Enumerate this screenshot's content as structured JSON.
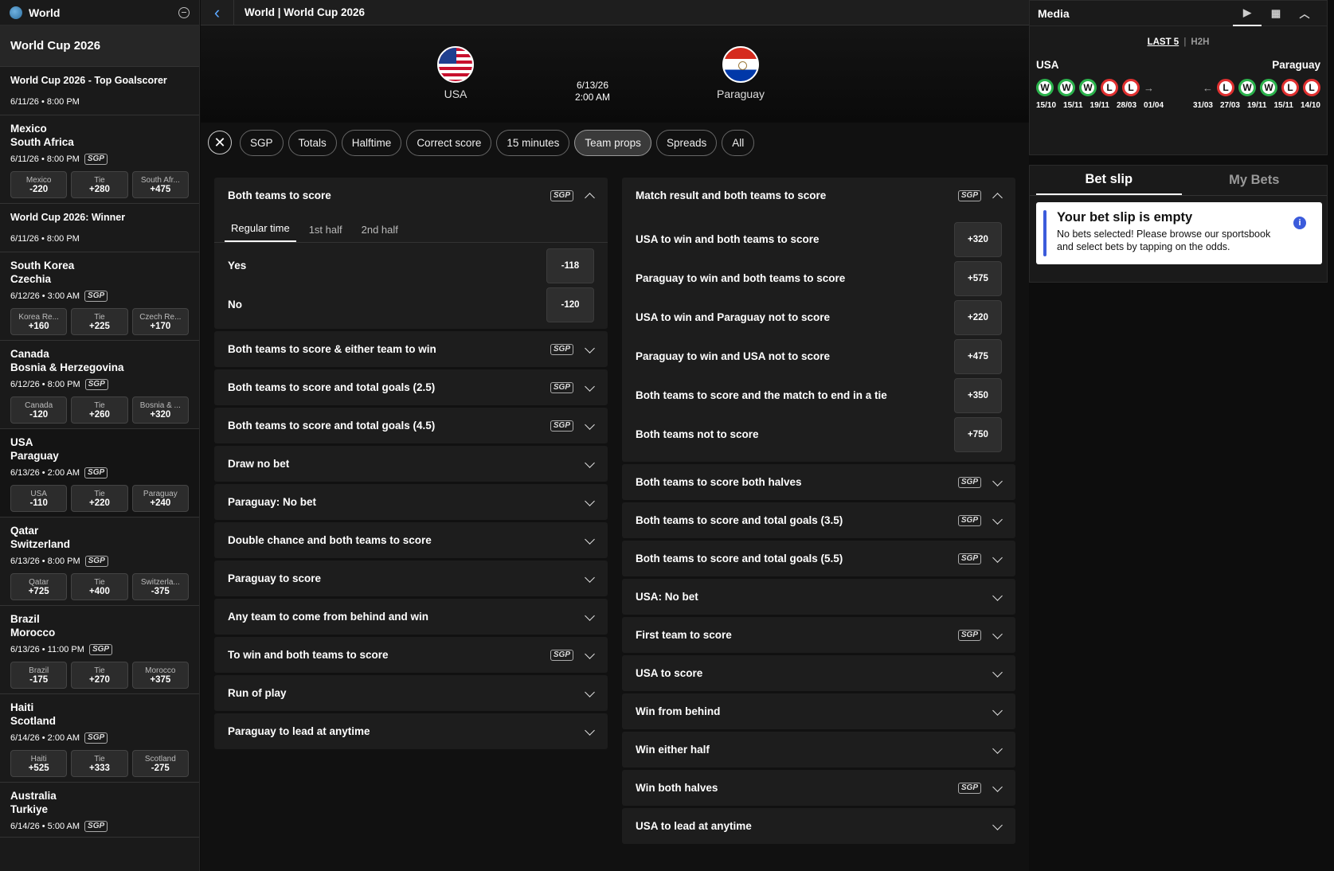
{
  "sidebar": {
    "title": "World",
    "section": "World Cup 2026",
    "outrights": [
      {
        "title": "World Cup 2026 - Top Goalscorer",
        "date": "6/11/26 • 8:00 PM"
      },
      {
        "title": "World Cup 2026: Winner",
        "date": "6/11/26 • 8:00 PM"
      }
    ],
    "matches": [
      {
        "home": "Mexico",
        "away": "South Africa",
        "date": "6/11/26 • 8:00 PM",
        "sgp": "SGP",
        "odds": [
          {
            "l": "Mexico",
            "v": "-220"
          },
          {
            "l": "Tie",
            "v": "+280"
          },
          {
            "l": "South Afr...",
            "v": "+475"
          }
        ]
      },
      {
        "home": "South Korea",
        "away": "Czechia",
        "date": "6/12/26 • 3:00 AM",
        "sgp": "SGP",
        "odds": [
          {
            "l": "Korea Re...",
            "v": "+160"
          },
          {
            "l": "Tie",
            "v": "+225"
          },
          {
            "l": "Czech Re...",
            "v": "+170"
          }
        ]
      },
      {
        "home": "Canada",
        "away": "Bosnia & Herzegovina",
        "date": "6/12/26 • 8:00 PM",
        "sgp": "SGP",
        "odds": [
          {
            "l": "Canada",
            "v": "-120"
          },
          {
            "l": "Tie",
            "v": "+260"
          },
          {
            "l": "Bosnia & ...",
            "v": "+320"
          }
        ]
      },
      {
        "home": "USA",
        "away": "Paraguay",
        "date": "6/13/26 • 2:00 AM",
        "sgp": "SGP",
        "odds": [
          {
            "l": "USA",
            "v": "-110"
          },
          {
            "l": "Tie",
            "v": "+220"
          },
          {
            "l": "Paraguay",
            "v": "+240"
          }
        ]
      },
      {
        "home": "Qatar",
        "away": "Switzerland",
        "date": "6/13/26 • 8:00 PM",
        "sgp": "SGP",
        "odds": [
          {
            "l": "Qatar",
            "v": "+725"
          },
          {
            "l": "Tie",
            "v": "+400"
          },
          {
            "l": "Switzerla...",
            "v": "-375"
          }
        ]
      },
      {
        "home": "Brazil",
        "away": "Morocco",
        "date": "6/13/26 • 11:00 PM",
        "sgp": "SGP",
        "odds": [
          {
            "l": "Brazil",
            "v": "-175"
          },
          {
            "l": "Tie",
            "v": "+270"
          },
          {
            "l": "Morocco",
            "v": "+375"
          }
        ]
      },
      {
        "home": "Haiti",
        "away": "Scotland",
        "date": "6/14/26 • 2:00 AM",
        "sgp": "SGP",
        "odds": [
          {
            "l": "Haiti",
            "v": "+525"
          },
          {
            "l": "Tie",
            "v": "+333"
          },
          {
            "l": "Scotland",
            "v": "-275"
          }
        ]
      },
      {
        "home": "Australia",
        "away": "Turkiye",
        "date": "6/14/26 • 5:00 AM",
        "sgp": "SGP",
        "odds": []
      }
    ]
  },
  "center": {
    "breadcrumb": "World | World Cup 2026",
    "home_team": "USA",
    "away_team": "Paraguay",
    "date": "6/13/26",
    "time": "2:00 AM",
    "filters": [
      "SGP",
      "Totals",
      "Halftime",
      "Correct score",
      "15 minutes",
      "Team props",
      "Spreads",
      "All"
    ],
    "active_filter": "Team props",
    "left_col": {
      "open_market": {
        "title": "Both teams to score",
        "sgp": "SGP",
        "tabs": [
          "Regular time",
          "1st half",
          "2nd half"
        ],
        "rows": [
          {
            "l": "Yes",
            "v": "-118"
          },
          {
            "l": "No",
            "v": "-120"
          }
        ]
      },
      "markets": [
        {
          "title": "Both teams to score & either team to win",
          "sgp": "SGP"
        },
        {
          "title": "Both teams to score and total goals (2.5)",
          "sgp": "SGP"
        },
        {
          "title": "Both teams to score and total goals (4.5)",
          "sgp": "SGP"
        },
        {
          "title": "Draw no bet",
          "sgp": ""
        },
        {
          "title": "Paraguay: No bet",
          "sgp": ""
        },
        {
          "title": "Double chance and both teams to score",
          "sgp": ""
        },
        {
          "title": "Paraguay to score",
          "sgp": ""
        },
        {
          "title": "Any team to come from behind and win",
          "sgp": ""
        },
        {
          "title": "To win and both teams to score",
          "sgp": "SGP"
        },
        {
          "title": "Run of play",
          "sgp": ""
        },
        {
          "title": "Paraguay to lead at anytime",
          "sgp": ""
        }
      ]
    },
    "right_col": {
      "open_market": {
        "title": "Match result and both teams to score",
        "sgp": "SGP",
        "rows": [
          {
            "l": "USA to win and both teams to score",
            "v": "+320"
          },
          {
            "l": "Paraguay to win and both teams to score",
            "v": "+575"
          },
          {
            "l": "USA to win and Paraguay not to score",
            "v": "+220"
          },
          {
            "l": "Paraguay to win and USA not to score",
            "v": "+475"
          },
          {
            "l": "Both teams to score and the match to end in a tie",
            "v": "+350"
          },
          {
            "l": "Both teams not to score",
            "v": "+750"
          }
        ]
      },
      "markets": [
        {
          "title": "Both teams to score both halves",
          "sgp": "SGP"
        },
        {
          "title": "Both teams to score and total goals (3.5)",
          "sgp": "SGP"
        },
        {
          "title": "Both teams to score and total goals (5.5)",
          "sgp": "SGP"
        },
        {
          "title": "USA: No bet",
          "sgp": ""
        },
        {
          "title": "First team to score",
          "sgp": "SGP"
        },
        {
          "title": "USA to score",
          "sgp": ""
        },
        {
          "title": "Win from behind",
          "sgp": ""
        },
        {
          "title": "Win either half",
          "sgp": ""
        },
        {
          "title": "Win both halves",
          "sgp": "SGP"
        },
        {
          "title": "USA to lead at anytime",
          "sgp": ""
        }
      ]
    }
  },
  "right": {
    "media_title": "Media",
    "form_tabs": [
      "LAST 5",
      "H2H"
    ],
    "home": "USA",
    "away": "Paraguay",
    "home_form": [
      "W",
      "W",
      "W",
      "L",
      "L"
    ],
    "away_form": [
      "L",
      "W",
      "W",
      "L",
      "L"
    ],
    "home_dates": [
      "15/10",
      "15/11",
      "19/11",
      "28/03",
      "01/04"
    ],
    "away_dates": [
      "31/03",
      "27/03",
      "19/11",
      "15/11",
      "14/10"
    ],
    "slip_tab": "Bet slip",
    "bets_tab": "My Bets",
    "empty_title": "Your bet slip is empty",
    "empty_body": "No bets selected! Please browse our sportsbook and select bets by tapping on the odds."
  }
}
